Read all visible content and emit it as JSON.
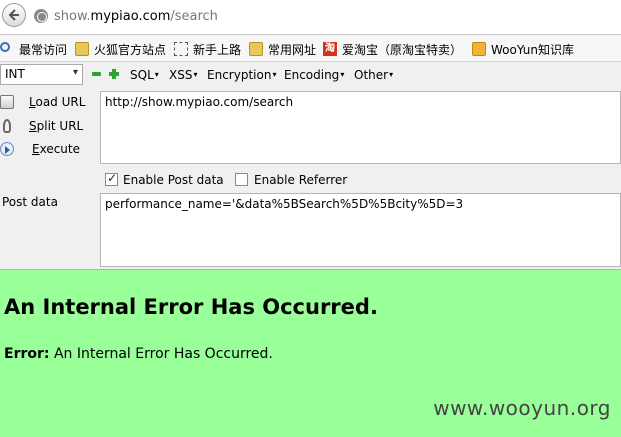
{
  "urlbar": {
    "url_prefix": "show.",
    "url_domain": "mypiao.com",
    "url_path": "/search"
  },
  "bookmarks": [
    {
      "icon": "search-icon",
      "label": "最常访问"
    },
    {
      "icon": "folder-icon",
      "label": "火狐官方站点"
    },
    {
      "icon": "page-icon",
      "label": "新手上路"
    },
    {
      "icon": "folder-icon",
      "label": "常用网址"
    },
    {
      "icon": "taobao-icon",
      "icon_text": "淘",
      "label": "爱淘宝（原淘宝特卖）"
    },
    {
      "icon": "rss-icon",
      "label": "WooYun知识库"
    }
  ],
  "hackbar": {
    "select_value": "INT",
    "menus": [
      "SQL",
      "XSS",
      "Encryption",
      "Encoding",
      "Other"
    ],
    "actions": [
      {
        "key": "L",
        "rest": "oad URL"
      },
      {
        "key": "S",
        "rest": "plit URL"
      },
      {
        "key": "E",
        "rest": "xecute"
      }
    ],
    "url_value": "http://show.mypiao.com/search",
    "enable_post_label": "Enable Post data",
    "enable_post_checked": true,
    "enable_referrer_label": "Enable Referrer",
    "enable_referrer_checked": false,
    "post_label": "Post data",
    "post_value": "performance_name='&data%5BSearch%5D%5Bcity%5D=3"
  },
  "page": {
    "heading": "An Internal Error Has Occurred.",
    "error_label": "Error:",
    "error_text": "An Internal Error Has Occurred.",
    "background": "#99ff99"
  },
  "watermark": "www.wooyun.org"
}
